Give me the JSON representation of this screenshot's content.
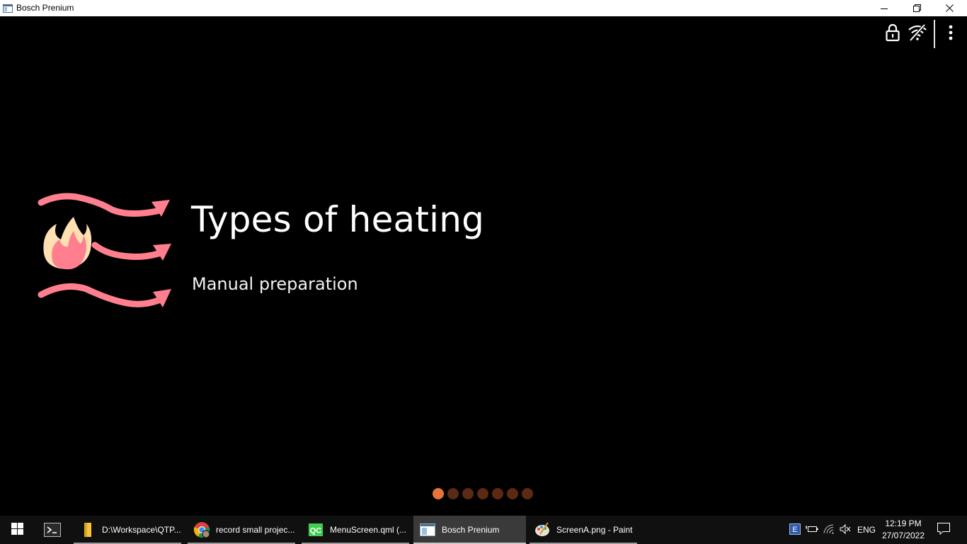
{
  "window": {
    "title": "Bosch Prenium",
    "minimize_icon": "minimize-icon",
    "restore_icon": "restore-icon",
    "close_icon": "close-icon"
  },
  "status_bar": {
    "icons": [
      "lock-icon",
      "wifi-off-icon",
      "more-vertical-icon"
    ]
  },
  "hero": {
    "title": "Types of heating",
    "subtitle": "Manual preparation",
    "illustration": "heating-flame-airflow-icon",
    "illustration_colors": {
      "arrows": "#ff7f8e",
      "flame_outer": "#ffe0b3",
      "flame_inner": "#ff7f8e"
    }
  },
  "pager": {
    "count": 7,
    "active_index": 0,
    "active_color": "#e8743b",
    "inactive_color": "#5b2a14"
  },
  "taskbar": {
    "start_icon": "windows-start-icon",
    "items": [
      {
        "label": "",
        "icon": "terminal-icon"
      },
      {
        "label": "D:\\Workspace\\QTP...",
        "icon": "folder-icon"
      },
      {
        "label": "record small projec...",
        "icon": "chrome-icon"
      },
      {
        "label": "MenuScreen.qml (...",
        "icon": "qt-creator-icon"
      },
      {
        "label": "Bosch Prenium",
        "icon": "app-window-icon"
      },
      {
        "label": "ScreenA.png - Paint",
        "icon": "paint-icon"
      }
    ],
    "tray": {
      "language": "ENG",
      "icons": [
        "keyboard-ime-icon",
        "battery-icon",
        "network-icon",
        "volume-muted-icon",
        "notifications-icon"
      ]
    },
    "clock": {
      "time": "12:19 PM",
      "date": "27/07/2022"
    }
  }
}
